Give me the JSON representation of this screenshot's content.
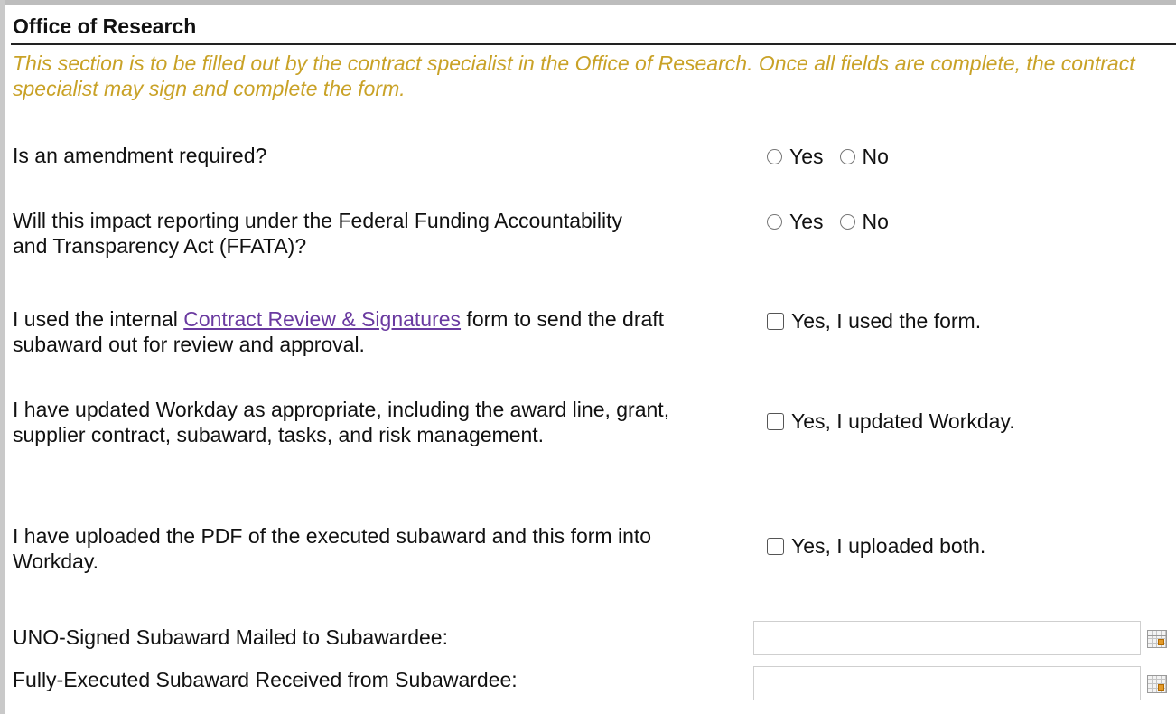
{
  "section": {
    "title": "Office of Research",
    "instructions": "This section is to be filled out by the contract specialist in the Office of Research. Once all fields are complete, the contract specialist may sign and complete the form."
  },
  "questions": {
    "amendment": {
      "label": "Is an amendment required?",
      "options": [
        "Yes",
        "No"
      ],
      "selected": null
    },
    "ffata": {
      "label": "Will this impact reporting under the Federal Funding Accountability and Transparency Act (FFATA)?",
      "options": [
        "Yes",
        "No"
      ],
      "selected": null
    },
    "contract_review": {
      "label_before": "I used the internal ",
      "link_text": "Contract Review & Signatures",
      "label_after": " form to send the draft subaward out for review and approval.",
      "checkbox_label": "Yes, I used the form.",
      "checked": false
    },
    "workday_update": {
      "label": "I have updated Workday as appropriate, including the award line, grant, supplier contract, subaward, tasks, and risk management.",
      "checkbox_label": "Yes, I updated Workday.",
      "checked": false
    },
    "uploaded": {
      "label": "I have uploaded the PDF of the executed subaward and this form into Workday.",
      "checkbox_label": "Yes, I uploaded both.",
      "checked": false
    }
  },
  "dates": {
    "mailed": {
      "label": "UNO-Signed Subaward Mailed to Subawardee:",
      "value": ""
    },
    "received": {
      "label": "Fully-Executed Subaward Received from Subawardee:",
      "value": ""
    }
  },
  "colors": {
    "instructions": "#c9a227",
    "link": "#6a3aa0"
  },
  "icons": {
    "calendar": "calendar-icon"
  }
}
